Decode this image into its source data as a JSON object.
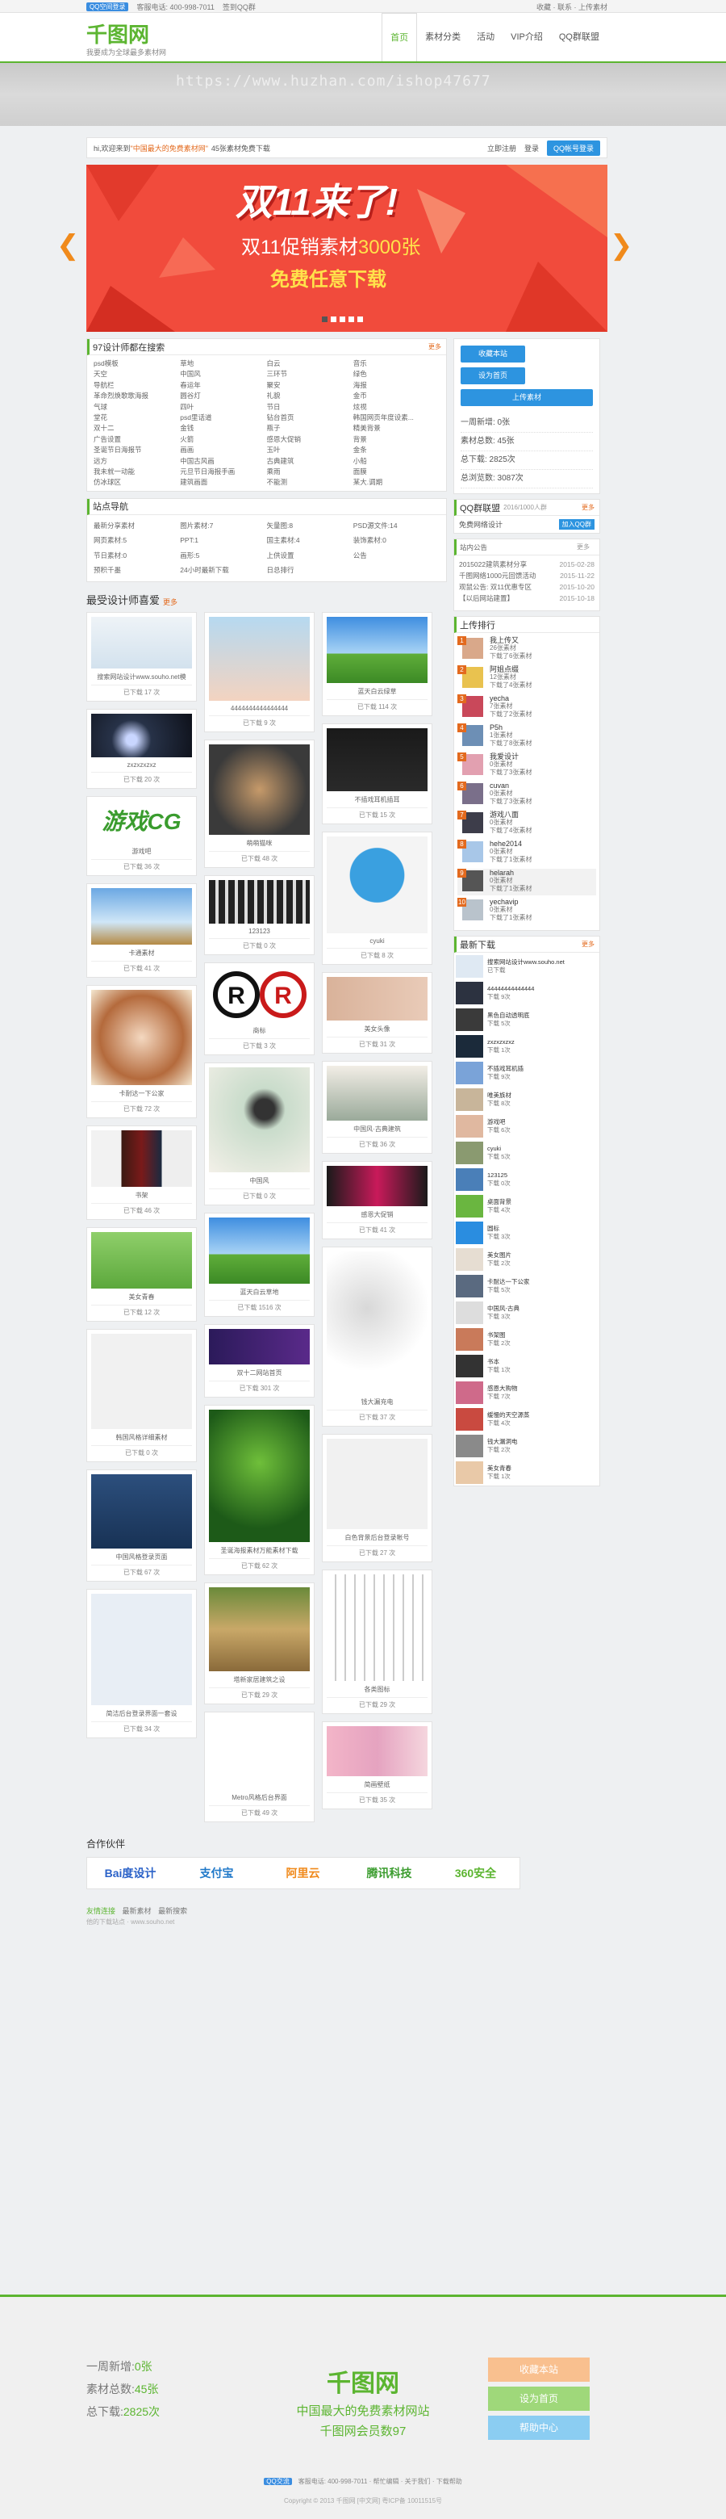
{
  "topbar": {
    "qq_login": "QQ空间登录",
    "service": "客服电话: 400-998-7011",
    "sign": "签到QQ群",
    "right": "收藏 · 联系 · 上传素材"
  },
  "header": {
    "logo": "千图网",
    "slogan": "我要成为全球最多素材网",
    "nav": [
      "首页",
      "素材分类",
      "活动",
      "VIP介绍",
      "QQ群联盟"
    ]
  },
  "watermark": "https://www.huzhan.com/ishop47677",
  "welcome": {
    "prefix": "hi,欢迎来到",
    "highlight": "\"中国最大的免费素材网\"",
    "suffix": "45张素材免费下载",
    "register": "立即注册",
    "login": "登录",
    "qq": "QQ帐号登录"
  },
  "banner": {
    "title": "双11来了!",
    "line2_a": "双11促销素材",
    "line2_b": "3000张",
    "line3": "免费任意下载",
    "arrow_left": "❮",
    "arrow_right": "❯"
  },
  "keywords": {
    "title": "97设计师都在搜索",
    "more": "更多",
    "items": [
      "psd模板",
      "草地",
      "白云",
      "音乐",
      "天空",
      "中国风",
      "三环节",
      "绿色",
      "导航栏",
      "春运年",
      "聚安",
      "海报",
      "革命烈焕歌歌海报",
      "圆谷灯",
      "礼貌",
      "金币",
      "气球",
      "四叶",
      "节日",
      "炫视",
      "堂花",
      "psd里话道",
      "钻台首页",
      "韩国网页年度设素...",
      "双十二",
      "金钱",
      "瓶子",
      "精美背景",
      "广告设置",
      "火箭",
      "感恩大促销",
      "背景",
      "圣诞节日海报节",
      "画画",
      "玉叶",
      "金条",
      "远方",
      "中国古风画",
      "古典建筑",
      "小船",
      "我未就一动能",
      "元旦节日海报手画",
      "乘雨",
      "面膜",
      "仿冰球区",
      "建筑画面",
      "不能测",
      "某大.调期"
    ]
  },
  "sitenav": {
    "title": "站点导航",
    "items": [
      "最新分享素材",
      "图片素材:7",
      "矢量图:8",
      "PSD源文件:14",
      "网页素材:5",
      "PPT:1",
      "国主素材:4",
      "装饰素材:0",
      "节日素材:0",
      "画形:5",
      "上供设置",
      "公告",
      "预积千墨",
      "24小时最新下载",
      "日总排行"
    ]
  },
  "sidebar": {
    "btn_fav": "收藏本站",
    "btn_home": "设为首页",
    "btn_upload": "上传素材",
    "stats": [
      "一周新增: 0张",
      "素材总数: 45张",
      "总下载: 2825次",
      "总浏览数: 3087次"
    ],
    "qq_title": "QQ群联盟",
    "qq_sub": "2016/1000人群",
    "qq_more": "更多",
    "qq_name": "免费网络设计",
    "qq_join": "加入QQ群"
  },
  "notice": {
    "title": "站内公告",
    "more": "更多",
    "items": [
      {
        "t": "2015022建筑素材分享",
        "d": "2015-02-28"
      },
      {
        "t": "千图网络1000元回馈活动",
        "d": "2015-11-22"
      },
      {
        "t": "观鼠公告: 双11优惠专区",
        "d": "2015-10-20"
      },
      {
        "t": "【以后网站建置】",
        "d": "2015-10-18"
      }
    ]
  },
  "ranking": {
    "title": "上传排行",
    "items": [
      {
        "n": "1",
        "name": "我上传又",
        "a": "26张素材",
        "b": "下载了6张素材"
      },
      {
        "n": "2",
        "name": "阿姐点缀",
        "a": "12张素材",
        "b": "下载了4张素材"
      },
      {
        "n": "3",
        "name": "yecha",
        "a": "7张素材",
        "b": "下载了2张素材"
      },
      {
        "n": "4",
        "name": "P5h",
        "a": "1张素材",
        "b": "下载了8张素材"
      },
      {
        "n": "5",
        "name": "我爱设计",
        "a": "0张素材",
        "b": "下载了3张素材"
      },
      {
        "n": "6",
        "name": "cuvan",
        "a": "0张素材",
        "b": "下载了3张素材"
      },
      {
        "n": "7",
        "name": "游戏八面",
        "a": "0张素材",
        "b": "下载了4张素材"
      },
      {
        "n": "8",
        "name": "hehe2014",
        "a": "0张素材",
        "b": "下载了1张素材"
      },
      {
        "n": "9",
        "name": "helarah",
        "a": "0张素材",
        "b": "下载了1张素材"
      },
      {
        "n": "10",
        "name": "yechavip",
        "a": "0张素材",
        "b": "下载了1张素材"
      }
    ]
  },
  "latest": {
    "title": "最新下载",
    "more": "更多",
    "items": [
      {
        "nm": "搜索网站设计www.souho.net",
        "ct": "已下载"
      },
      {
        "nm": "44444444444444",
        "ct": "下载 9次"
      },
      {
        "nm": "黑色自动透明底",
        "ct": "下载 5次"
      },
      {
        "nm": "zxzxzxzxz",
        "ct": "下载 1次"
      },
      {
        "nm": "不插戏耳机插",
        "ct": "下载 9次"
      },
      {
        "nm": "唯美族材",
        "ct": "下载 8次"
      },
      {
        "nm": "游戏吧",
        "ct": "下载 6次"
      },
      {
        "nm": "cyuki",
        "ct": "下载 5次"
      },
      {
        "nm": "123125",
        "ct": "下载 0次"
      },
      {
        "nm": "桌面背景",
        "ct": "下载 4次"
      },
      {
        "nm": "圆标",
        "ct": "下载 3次"
      },
      {
        "nm": "美女图片",
        "ct": "下载 2次"
      },
      {
        "nm": "卡耐达一下公家",
        "ct": "下载 5次"
      },
      {
        "nm": "中国风-古典",
        "ct": "下载 3次"
      },
      {
        "nm": "书架图",
        "ct": "下载 2次"
      },
      {
        "nm": "书本",
        "ct": "下载 1次"
      },
      {
        "nm": "感恩大购物",
        "ct": "下载 7次"
      },
      {
        "nm": "缓慢的天空源蒸",
        "ct": "下载 4次"
      },
      {
        "nm": "钱大漏洞电",
        "ct": "下载 2次"
      },
      {
        "nm": "美女青春",
        "ct": "下载 1次"
      }
    ]
  },
  "showcase": {
    "title": "最受设计师喜爱",
    "more": "更多"
  },
  "cards": {
    "c1": [
      {
        "t": "搜索网站设计www.souho.net模",
        "d": "已下载 17 次",
        "h": 64,
        "k": "web"
      },
      {
        "t": "zxzxzxzxz",
        "d": "已下载 20 次",
        "h": 54,
        "k": "dark"
      },
      {
        "t": "游戏吧",
        "d": "已下载 36 次",
        "h": 52,
        "k": "game"
      },
      {
        "t": "卡通素材",
        "d": "已下载 41 次",
        "h": 70,
        "k": "sky"
      },
      {
        "t": "卡耐达一下公家",
        "d": "已下载 72 次",
        "h": 118,
        "k": "anime"
      },
      {
        "t": "书架",
        "d": "已下载 46 次",
        "h": 70,
        "k": "book"
      },
      {
        "t": "美女青春",
        "d": "已下载 12 次",
        "h": 70,
        "k": "girl"
      },
      {
        "t": "韩国风格详细素材",
        "d": "已下载 0 次",
        "h": 118,
        "k": "blank"
      },
      {
        "t": "中国风格登录页面",
        "d": "已下载 67 次",
        "h": 92,
        "k": "login"
      },
      {
        "t": "简洁后台登录界面一套设",
        "d": "已下载 34 次",
        "h": 138,
        "k": "admin"
      }
    ],
    "c2": [
      {
        "t": "4444444444444444",
        "d": "已下载 9 次",
        "h": 104,
        "k": "woman"
      },
      {
        "t": "萌萌猫咪",
        "d": "已下载 48 次",
        "h": 112,
        "k": "cat"
      },
      {
        "t": "123123",
        "d": "已下载 0 次",
        "h": 54,
        "k": "people"
      },
      {
        "t": "商标",
        "d": "已下载 3 次",
        "h": 68,
        "k": "reg"
      },
      {
        "t": "中国风",
        "d": "已下载 0 次",
        "h": 130,
        "k": "ink"
      },
      {
        "t": "蓝天白云草地",
        "d": "已下载 1516 次",
        "h": 82,
        "k": "field"
      },
      {
        "t": "双十二网站首页",
        "d": "已下载 301 次",
        "h": 44,
        "k": "d12"
      },
      {
        "t": "圣诞海报素材万能素材下载",
        "d": "已下载 62 次",
        "h": 164,
        "k": "xmas"
      },
      {
        "t": "塔新家居建筑之设",
        "d": "已下载 29 次",
        "h": 104,
        "k": "house"
      },
      {
        "t": "Metro风格后台界面",
        "d": "已下载 49 次",
        "h": 90,
        "k": "metro"
      }
    ],
    "c3": [
      {
        "t": "蓝天白云绿草",
        "d": "已下载 114 次",
        "h": 82,
        "k": "field"
      },
      {
        "t": "不插戏耳机插耳",
        "d": "已下载 15 次",
        "h": 78,
        "k": "earphone"
      },
      {
        "t": "cyuki",
        "d": "已下载 8 次",
        "h": 120,
        "k": "pocoyo"
      },
      {
        "t": "美女头像",
        "d": "已下载 31 次",
        "h": 54,
        "k": "face"
      },
      {
        "t": "中国风·古典建筑",
        "d": "已下载 36 次",
        "h": 68,
        "k": "ink2"
      },
      {
        "t": "感恩大促销",
        "d": "已下载 41 次",
        "h": 50,
        "k": "promo"
      },
      {
        "t": "钱大漏充电",
        "d": "已下载 37 次",
        "h": 176,
        "k": "charger"
      },
      {
        "t": "白色背景后台登录帐号",
        "d": "已下载 27 次",
        "h": 112,
        "k": "blank"
      },
      {
        "t": "各类图标",
        "d": "已下载 29 次",
        "h": 132,
        "k": "icons"
      },
      {
        "t": "简画壁纸",
        "d": "已下载 35 次",
        "h": 62,
        "k": "pink"
      }
    ]
  },
  "partners": {
    "title": "合作伙伴",
    "items": [
      {
        "n": "Bai度设计",
        "c": "#2b62c8"
      },
      {
        "n": "支付宝",
        "c": "#1f78c8"
      },
      {
        "n": "阿里云",
        "c": "#f08a1c"
      },
      {
        "n": "腾讯科技",
        "c": "#3a9c2e"
      },
      {
        "n": "360安全",
        "c": "#5cb531"
      }
    ]
  },
  "links": {
    "title": "友情连接",
    "items": [
      "最新素材",
      "最新搜索"
    ],
    "url": "他的下载站点 · www.souho.net"
  },
  "footer": {
    "stats": [
      {
        "l": "一周新增:",
        "v": "0张"
      },
      {
        "l": "素材总数:",
        "v": "45张"
      },
      {
        "l": "总下载:",
        "v": "2825次"
      }
    ],
    "logo": "千图网",
    "slogan1": "中国最大的免费素材网站",
    "slogan2": "千图网会员数97",
    "btn1": "收藏本站",
    "btn2": "设为首页",
    "btn3": "帮助中心",
    "qq": "QQ交流",
    "line": "客服电话: 400-998-7011 · 帮忙编辑 · 关于我们 · 下载帮助",
    "copy": "Copyright © 2013 千图网 [中文网] 粤ICP备 10011515号"
  },
  "colors": {
    "brand": "#5cb531",
    "accent": "#e36a1e",
    "blue": "#2d94e0",
    "banner": "#f14b3c"
  }
}
